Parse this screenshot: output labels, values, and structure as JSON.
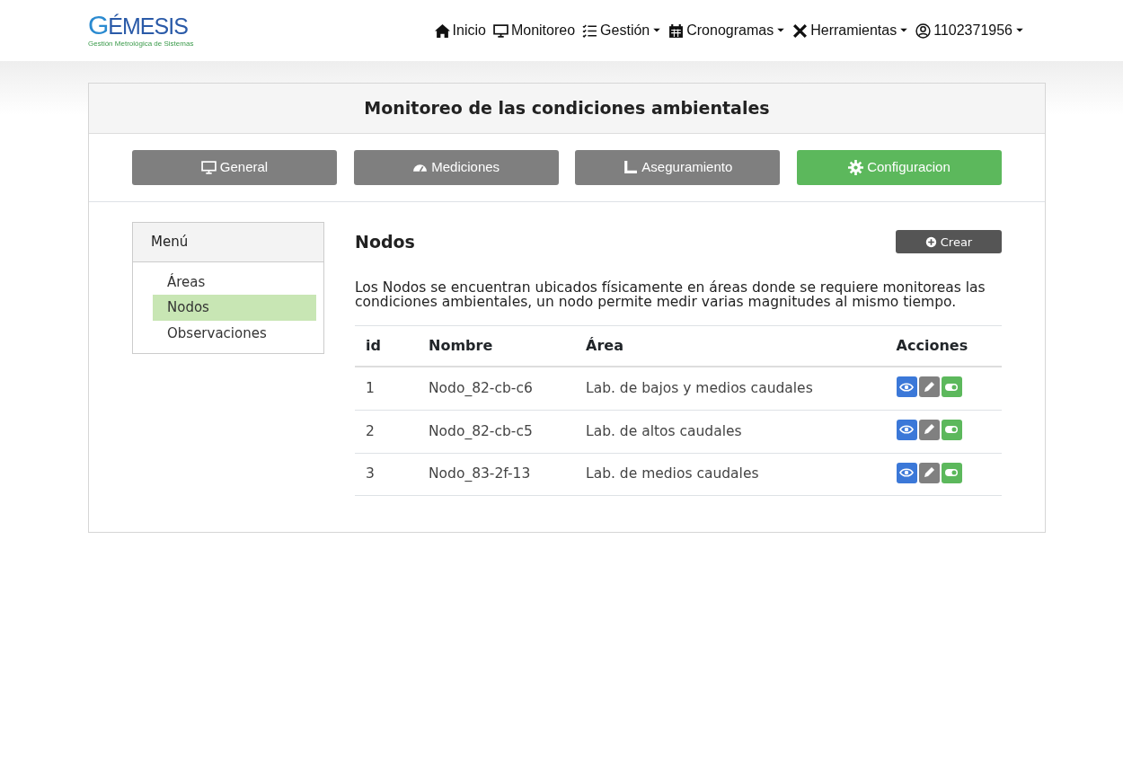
{
  "logo": {
    "title": "GÉMESIS",
    "subtitle": "Gestión Metrológica de Sistemas"
  },
  "nav": [
    {
      "label": "Inicio",
      "dropdown": false
    },
    {
      "label": "Monitoreo",
      "dropdown": false
    },
    {
      "label": "Gestión",
      "dropdown": true
    },
    {
      "label": "Cronogramas",
      "dropdown": true
    },
    {
      "label": "Herramientas",
      "dropdown": true
    },
    {
      "label": "1102371956",
      "dropdown": true
    }
  ],
  "page_title": "Monitoreo de las condiciones ambientales",
  "tabs": [
    {
      "label": "General",
      "selected": false
    },
    {
      "label": "Mediciones",
      "selected": false
    },
    {
      "label": "Aseguramiento",
      "selected": false
    },
    {
      "label": "Configuracion",
      "selected": true
    }
  ],
  "menu": {
    "title": "Menú",
    "items": [
      {
        "label": "Áreas",
        "selected": false
      },
      {
        "label": "Nodos",
        "selected": true
      },
      {
        "label": "Observaciones",
        "selected": false
      }
    ]
  },
  "section": {
    "title": "Nodos",
    "create_button": "Crear",
    "description": "Los Nodos se encuentran ubicados físicamente en áreas donde se requiere monitoreas las condiciones ambientales, un nodo permite medir varias magnitudes al mismo tiempo."
  },
  "table": {
    "columns": [
      "id",
      "Nombre",
      "Área",
      "Acciones"
    ],
    "rows": [
      {
        "id": "1",
        "name": "Nodo_82-cb-c6",
        "area": "Lab. de bajos y medios caudales",
        "on": true
      },
      {
        "id": "2",
        "name": "Nodo_82-cb-c5",
        "area": "Lab. de altos caudales",
        "on": true
      },
      {
        "id": "3",
        "name": "Nodo_83-2f-13",
        "area": "Lab. de medios caudales",
        "on": true
      }
    ]
  }
}
